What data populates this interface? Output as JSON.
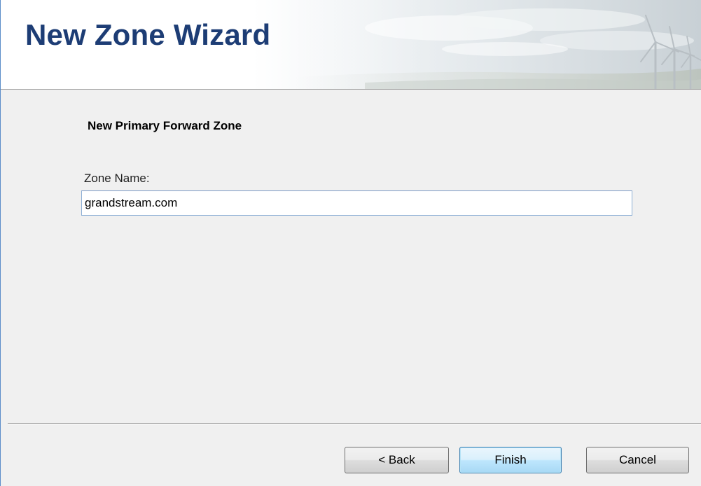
{
  "window": {
    "title": "New Zone Wizard"
  },
  "page": {
    "section_title": "New Primary Forward Zone",
    "zone_name_label": "Zone Name:",
    "zone_name_value": "grandstream.com"
  },
  "buttons": {
    "back": "< Back",
    "finish": "Finish",
    "cancel": "Cancel"
  },
  "colors": {
    "title_text": "#1d3d75",
    "window_border": "#5a8cc8",
    "panel_background": "#f0f0f0",
    "default_button_border": "#3c7fb1"
  },
  "icons": {
    "banner": "wind-turbines-illustration"
  }
}
